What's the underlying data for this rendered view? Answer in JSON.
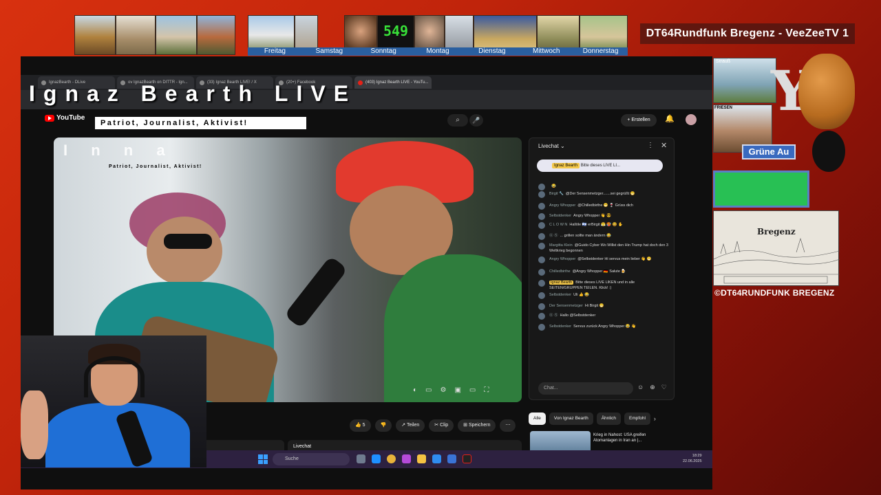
{
  "top_strip": {
    "weekdays": [
      "Freitag",
      "Samstag",
      "Sonntag",
      "Montag",
      "Dienstag",
      "Mittwoch",
      "Donnerstag"
    ],
    "counter": "549"
  },
  "station_title": "DT64Rundfunk Bregenz - VeeZeeTV 1",
  "browser": {
    "tabs": [
      "IgnazBearth - DLive",
      "ov IgnazBearth on DITTR - Ign...",
      "(33) Ignaz Bearth LIVE! / X",
      "(20+) Facebook",
      "(403) Ignaz Bearth LIVE - YouTu..."
    ],
    "active_tab_index": 4
  },
  "overlay": {
    "title": "Ignaz Bearth LIVE",
    "tagline": "Patriot, Journalist, Aktivist!"
  },
  "youtube": {
    "logo": "YouTube",
    "create_label": "+ Erstellen",
    "video_overlay_title": "I n        n a",
    "video_overlay_sub": "Patriot, Journalist, Aktivist!",
    "actions": [
      "👍 5",
      "👎",
      "↗ Teilen",
      "✂ Clip",
      "⊞ Speichern",
      "⋯"
    ],
    "chips": [
      "Alle",
      "Von Ignaz Bearth",
      "Ähnlich",
      "Empfohl"
    ],
    "rec_title": "Krieg in Nahost: USA greifen Atomanlagen in Iran an |...",
    "lower_livechat": "Livechat"
  },
  "chat": {
    "title": "Livechat",
    "pinned_author": "Ignaz Bearth",
    "pinned_text": "Bitte dieses LIVE LI...",
    "input_placeholder": "Chat...",
    "messages": [
      {
        "author": "",
        "text": "😂"
      },
      {
        "author": "Birgit 🔧",
        "text": "@Der Sensenmetzger.......sei gegrüßt 😁"
      },
      {
        "author": "Angry Whopper",
        "text": "@Chilledbirthe 😁 🍷 Grüss dich"
      },
      {
        "author": "Selbstdenker",
        "text": "Angry Whopper 👋 😎"
      },
      {
        "author": "C L O W N",
        "text": "Hallöle 🇮🇱 erBirgit 😤 🥵 😆 ✋"
      },
      {
        "author": "Ⓤ Ⓢ",
        "text": "... grillen sollte man ändern 😂"
      },
      {
        "author": "Margitta Klein",
        "text": "@Guido Cyber Wo Willst den Hin Trump hat doch den 3 Weltkrieg begonnen"
      },
      {
        "author": "Angry Whopper",
        "text": "@Selbstdenker Hi servus mein lieber 👋 😁"
      },
      {
        "author": "Chilledbirthe",
        "text": "@Angry Whopper 🇩🇪 Salute 🍺"
      },
      {
        "author": "Ignaz Bearth",
        "text": "Bitte dieses LIVE LIKEN und in alle SEITEN/GRUPPEN TEILEN. Klick! :)",
        "owner": true
      },
      {
        "author": "Selbstdenker",
        "text": "Uli 👍 😂"
      },
      {
        "author": "Der Sensenmetzger",
        "text": "Hi Birgit 😁"
      },
      {
        "author": "Ⓤ Ⓢ",
        "text": "Hallo @Selbstdenker"
      },
      {
        "author": "Selbstdenker",
        "text": "Servus zurück Angry Whopper 😂 👋"
      }
    ]
  },
  "taskbar": {
    "search_label": "Suche",
    "time": "18:29",
    "date": "22.06.2025"
  },
  "side_panel": {
    "town1_label": "Strauß",
    "town2_label": "FRIESEN",
    "gruene_au": "Grüne Au",
    "engraving_text": "Bregenz",
    "copyright": "©DT64RUNDFUNK BREGENZ"
  }
}
